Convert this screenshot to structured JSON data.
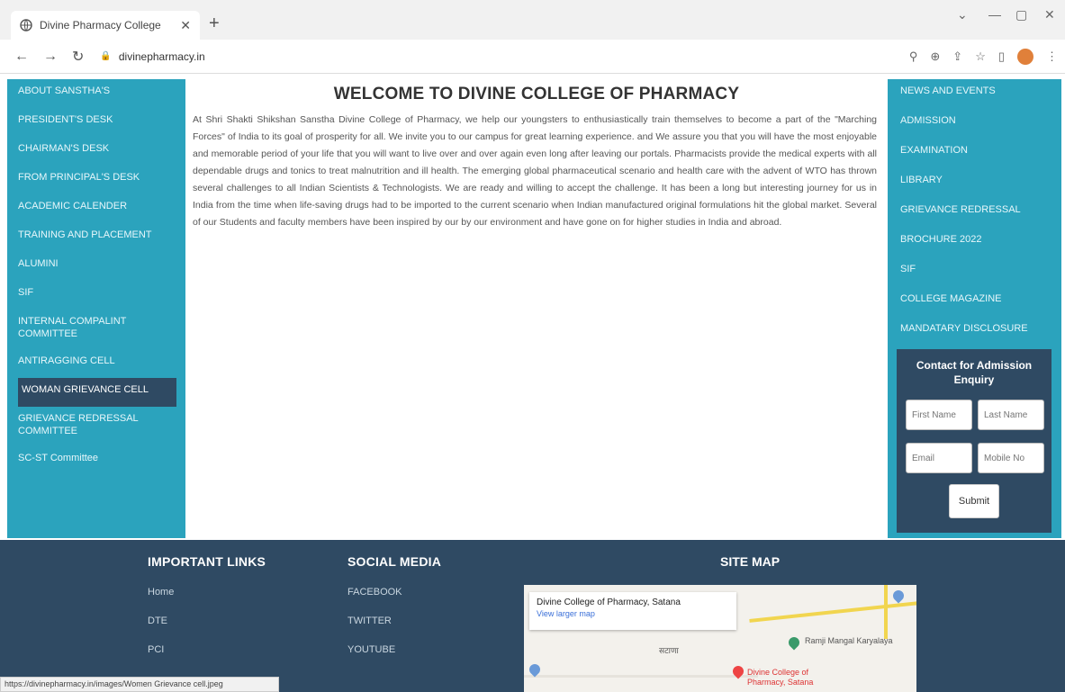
{
  "browser": {
    "tab_title": "Divine Pharmacy College",
    "url": "divinepharmacy.in",
    "status_url": "https://divinepharmacy.in/images/Women Grievance cell.jpeg"
  },
  "left_sidebar": [
    "ABOUT SANSTHA'S",
    "PRESIDENT'S DESK",
    "CHAIRMAN'S DESK",
    "FROM PRINCIPAL'S DESK",
    "ACADEMIC CALENDER",
    "TRAINING AND PLACEMENT",
    "ALUMINI",
    "SIF",
    "INTERNAL COMPALINT COMMITTEE",
    "ANTIRAGGING CELL",
    "WOMAN GRIEVANCE CELL",
    "GRIEVANCE REDRESSAL COMMITTEE",
    "SC-ST Committee"
  ],
  "main": {
    "heading": "WELCOME TO DIVINE COLLEGE OF PHARMACY",
    "paragraph": "At Shri Shakti Shikshan Sanstha Divine College of Pharmacy, we help our youngsters to enthusiastically train themselves to become a part of the \"Marching Forces\" of India to its goal of prosperity for all. We invite you to our campus for great learning experience. and We assure you that you will have the most enjoyable and memorable period of your life that you will want to live over and over again even long after leaving our portals. Pharmacists provide the medical experts with all dependable drugs and tonics to treat malnutrition and ill health. The emerging global pharmaceutical scenario and health care with the advent of WTO has thrown several challenges to all Indian Scientists & Technologists. We are ready and willing to accept the challenge. It has been a long but interesting journey for us in India from the time when life-saving drugs had to be imported to the current scenario when Indian manufactured original formulations hit the global market. Several of our Students and faculty members have been inspired by our by our environment and have gone on for higher studies in India and abroad."
  },
  "right_sidebar": [
    "NEWS AND EVENTS",
    "ADMISSION",
    "EXAMINATION",
    "LIBRARY",
    "GRIEVANCE REDRESSAL",
    "BROCHURE 2022",
    "SIF",
    "COLLEGE MAGAZINE",
    "MANDATARY DISCLOSURE"
  ],
  "contact": {
    "title": "Contact for Admission Enquiry",
    "first_name_placeholder": "First Name",
    "last_name_placeholder": "Last Name",
    "email_placeholder": "Email",
    "mobile_placeholder": "Mobile No",
    "submit_label": "Submit"
  },
  "footer": {
    "important_title": "IMPORTANT LINKS",
    "important_links": [
      "Home",
      "DTE",
      "PCI"
    ],
    "social_title": "SOCIAL MEDIA",
    "social_links": [
      "FACEBOOK",
      "TWITTER",
      "YOUTUBE"
    ],
    "sitemap_title": "SITE MAP",
    "map_place": "Divine College of Pharmacy, Satana",
    "map_link": "View larger map",
    "map_marker_label": "Divine College of Pharmacy, Satana",
    "map_other_label": "Ramji Mangal Karyalaya",
    "map_local_label": "सटाणा"
  },
  "colors": {
    "sidebar": "#2ba3bd",
    "dark": "#2f4a63"
  }
}
